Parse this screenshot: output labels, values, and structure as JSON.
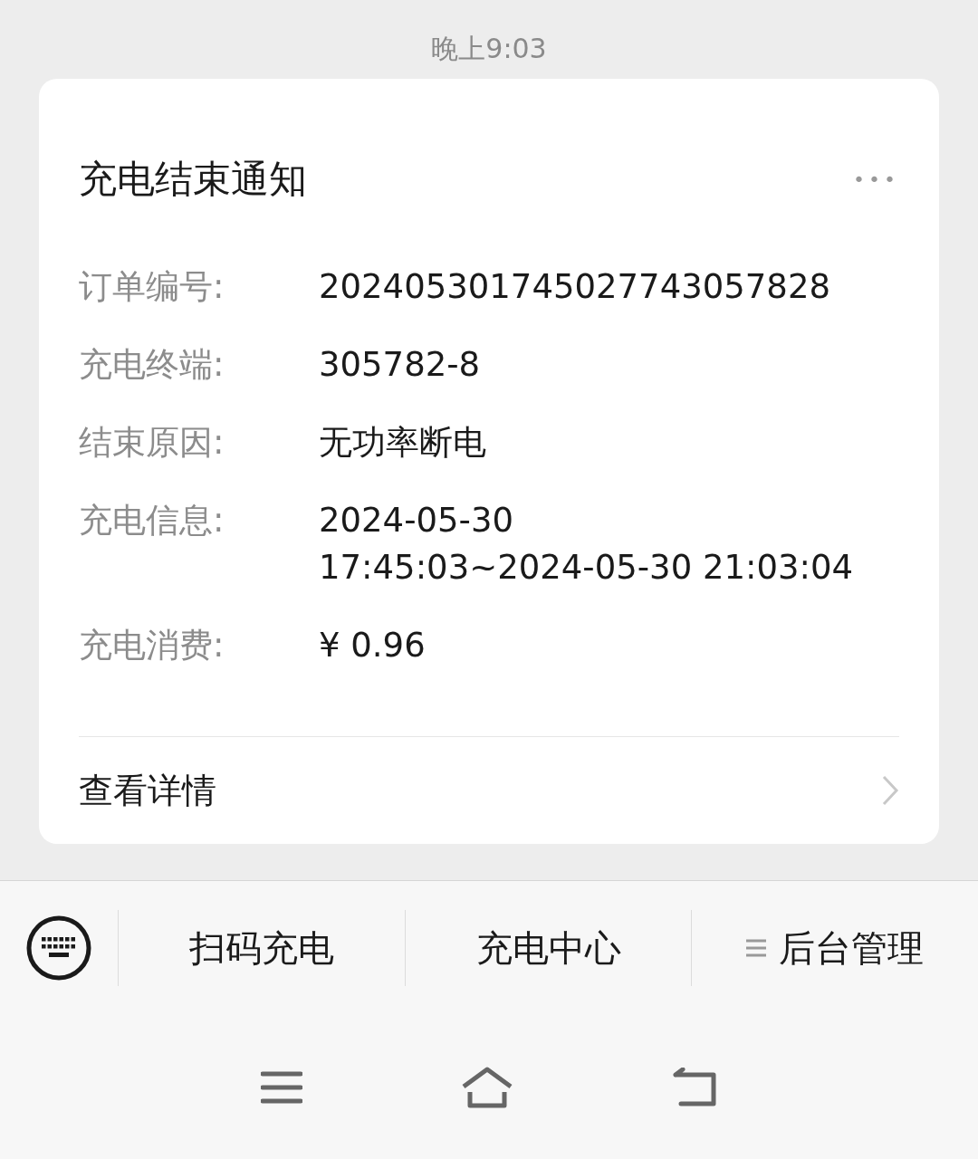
{
  "status_bar": {
    "time": "晚上9:03"
  },
  "card": {
    "title": "充电结束通知",
    "more": "•••",
    "fields": [
      {
        "label": "订单编号:",
        "lines": [
          "202405301745027743057828"
        ]
      },
      {
        "label": "充电终端:",
        "lines": [
          "305782-8"
        ]
      },
      {
        "label": "结束原因:",
        "lines": [
          "无功率断电"
        ]
      },
      {
        "label": "充电信息:",
        "lines": [
          "2024-05-30",
          "17:45:03~2024-05-30 21:03:04"
        ]
      },
      {
        "label": "充电消费:",
        "lines": [
          "¥ 0.96"
        ]
      }
    ],
    "link": "查看详情"
  },
  "menu": {
    "items": [
      {
        "label": "扫码充电",
        "kind": "plain"
      },
      {
        "label": "充电中心",
        "kind": "plain"
      },
      {
        "label": "后台管理",
        "kind": "submenu"
      }
    ]
  }
}
